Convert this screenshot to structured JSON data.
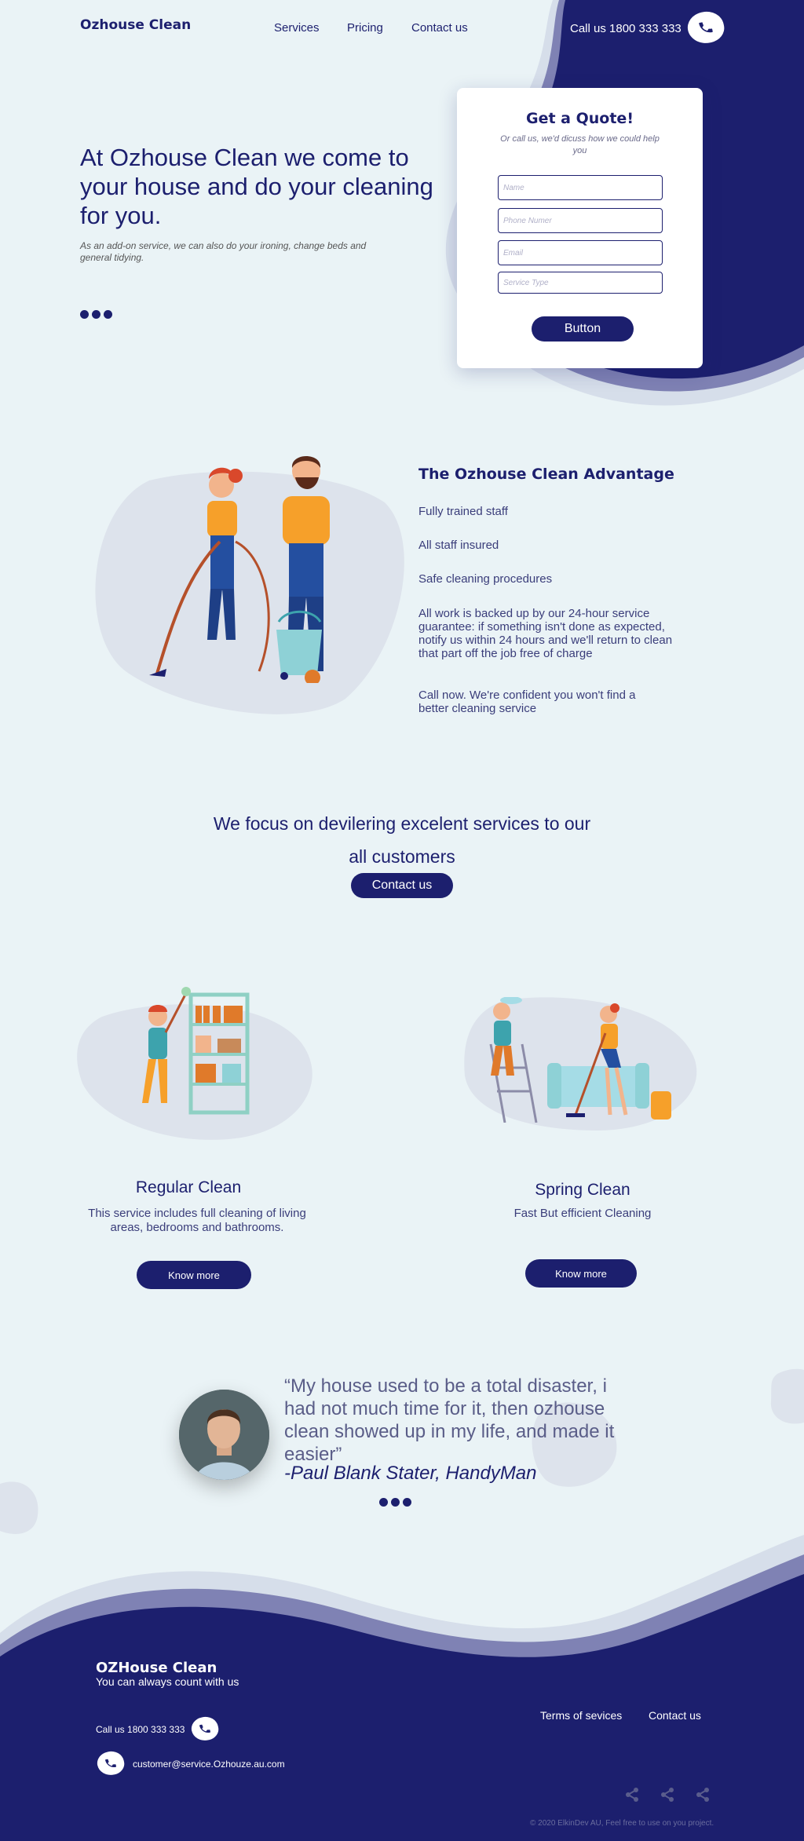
{
  "header": {
    "logo": "Ozhouse Clean",
    "nav": [
      "Services",
      "Pricing",
      "Contact us"
    ],
    "call": "Call us 1800 333 333"
  },
  "hero": {
    "title": "At Ozhouse Clean we come to your house and do your cleaning for you.",
    "subtitle": "As an add-on service, we can also do your ironing, change beds and general tidying."
  },
  "quote_form": {
    "title": "Get a Quote!",
    "subtitle": "Or call us, we'd dicuss how we could help you",
    "fields": [
      "Name",
      "Phone Numer",
      "Email",
      "Service Type"
    ],
    "button": "Button"
  },
  "advantage": {
    "title": "The Ozhouse Clean Advantage",
    "items": [
      "Fully trained staff",
      "All staff insured",
      "Safe cleaning procedures",
      "All work is backed up by our 24-hour service guarantee: if something isn't done as expected, notify us within 24 hours and we'll return to clean that part off the job free of charge",
      "Call now. We're confident you won't find a better cleaning service"
    ]
  },
  "focus": {
    "line1": "We focus on devilering excelent services to our",
    "line2": "all customers",
    "button": "Contact us"
  },
  "services": [
    {
      "title": "Regular Clean",
      "desc": "This service includes full cleaning of living areas, bedrooms and bathrooms.",
      "button": "Know more"
    },
    {
      "title": "Spring Clean",
      "desc": "Fast But efficient Cleaning",
      "button": "Know more"
    }
  ],
  "testimonial": {
    "quote": "“My house used to be a total disaster, i had not much time for it, then ozhouse clean showed up in my life, and  made it easier”",
    "author": "-Paul Blank Stater, HandyMan"
  },
  "footer": {
    "brand": "OZHouse Clean",
    "tagline": "You can always count with us",
    "call": "Call us 1800 333 333",
    "email": "customer@service.Ozhouze.au.com",
    "links": [
      "Terms of sevices",
      "Contact us"
    ],
    "copyright": "© 2020 ElkinDev AU,  Feel free to use on you project."
  },
  "colors": {
    "navy": "#1C1F6E",
    "background": "#EAF3F6",
    "blob": "#DDE3EC",
    "mid_wave": "#7F82B4"
  },
  "icons": [
    "phone-icon",
    "share-icon"
  ]
}
